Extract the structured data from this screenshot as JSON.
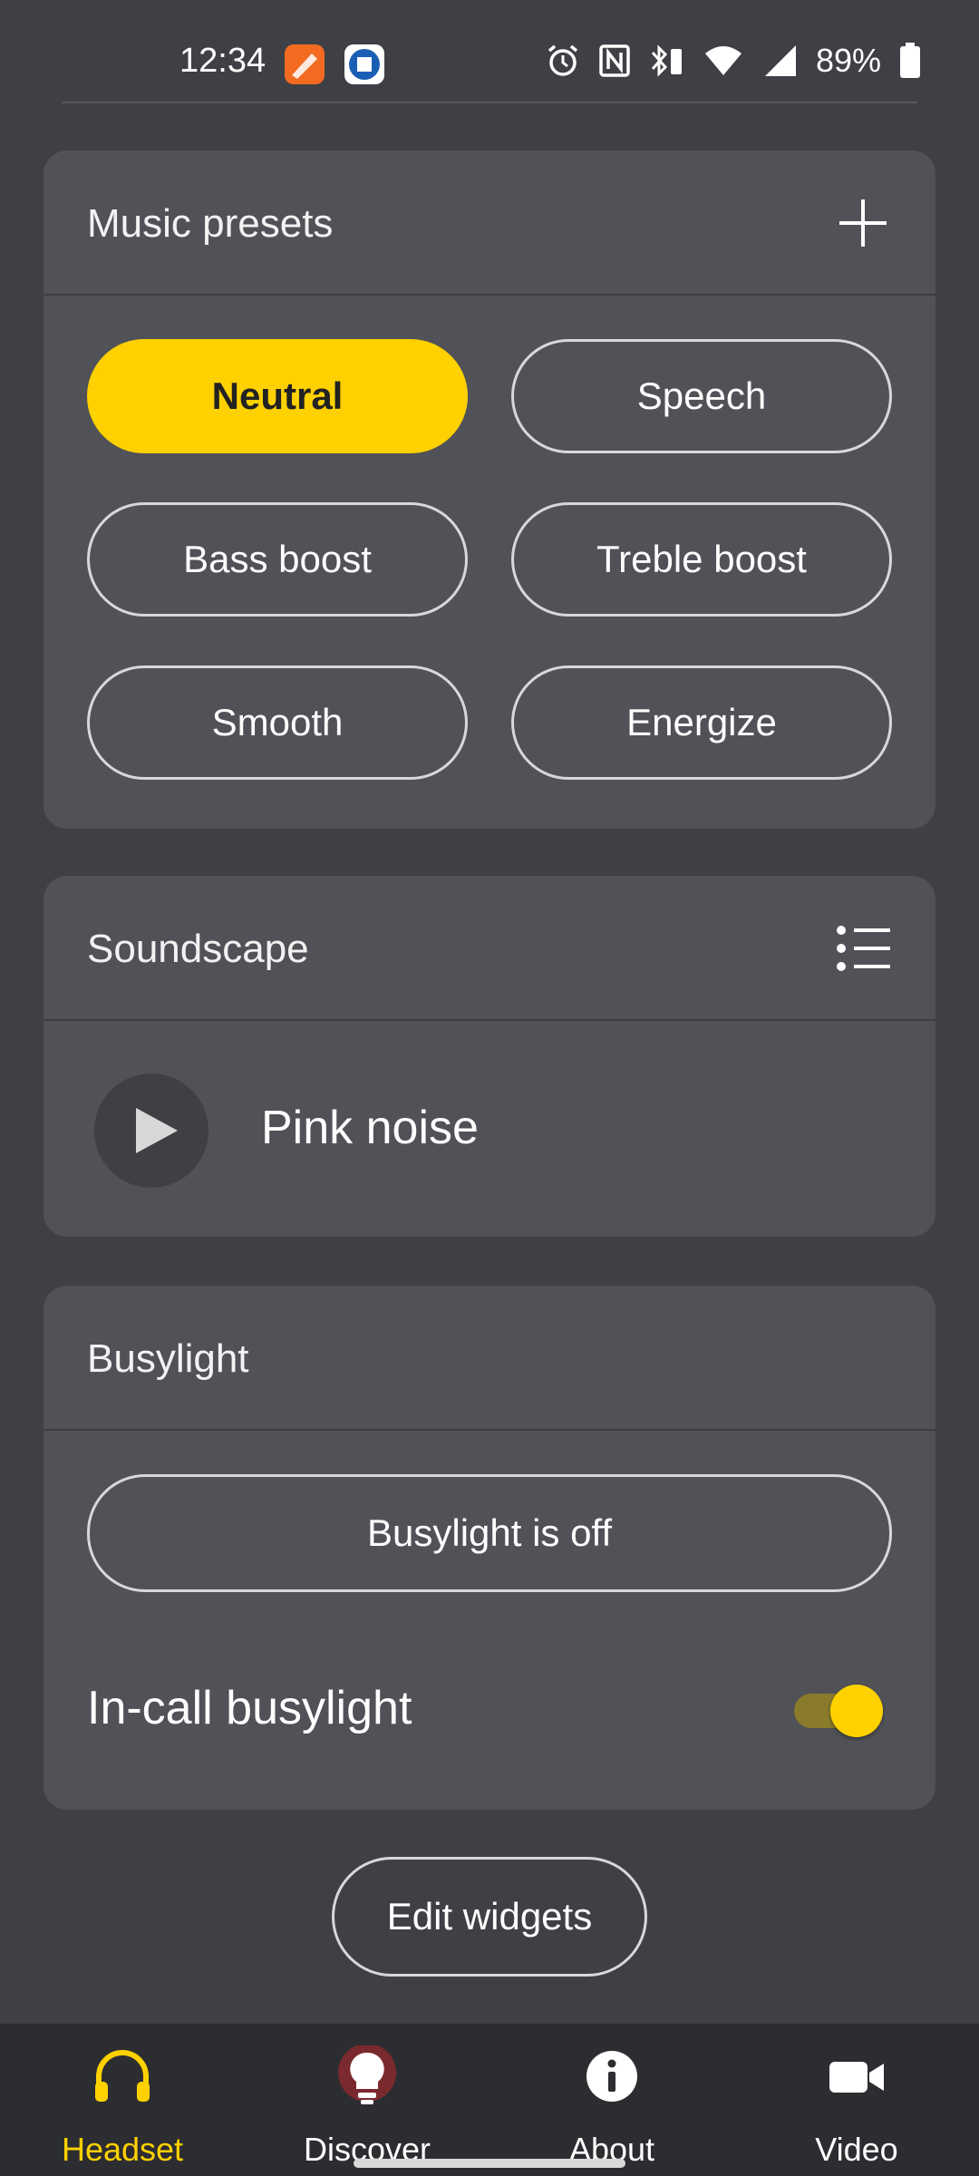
{
  "status_bar": {
    "time": "12:34",
    "battery_percent": "89%",
    "icons": [
      "alarm-icon",
      "nfc-icon",
      "bluetooth-battery-icon",
      "wifi-icon",
      "signal-icon",
      "battery-icon"
    ]
  },
  "music_presets": {
    "title": "Music presets",
    "add_icon": "plus-icon",
    "presets": [
      {
        "label": "Neutral",
        "selected": true
      },
      {
        "label": "Speech",
        "selected": false
      },
      {
        "label": "Bass boost",
        "selected": false
      },
      {
        "label": "Treble boost",
        "selected": false
      },
      {
        "label": "Smooth",
        "selected": false
      },
      {
        "label": "Energize",
        "selected": false
      }
    ]
  },
  "soundscape": {
    "title": "Soundscape",
    "list_icon": "list-icon",
    "current": "Pink noise",
    "play_icon": "play-icon"
  },
  "busylight": {
    "title": "Busylight",
    "button_label": "Busylight is off",
    "in_call_label": "In-call busylight",
    "in_call_enabled": true
  },
  "edit_widgets_label": "Edit widgets",
  "nav": {
    "items": [
      {
        "label": "Headset",
        "icon": "headset-icon",
        "active": true
      },
      {
        "label": "Discover",
        "icon": "lightbulb-icon",
        "active": false
      },
      {
        "label": "About",
        "icon": "info-icon",
        "active": false
      },
      {
        "label": "Video",
        "icon": "video-camera-icon",
        "active": false
      }
    ]
  },
  "colors": {
    "accent": "#ffd100",
    "background": "#3f4045",
    "card": "#515257",
    "navbar": "#2c2d31"
  }
}
